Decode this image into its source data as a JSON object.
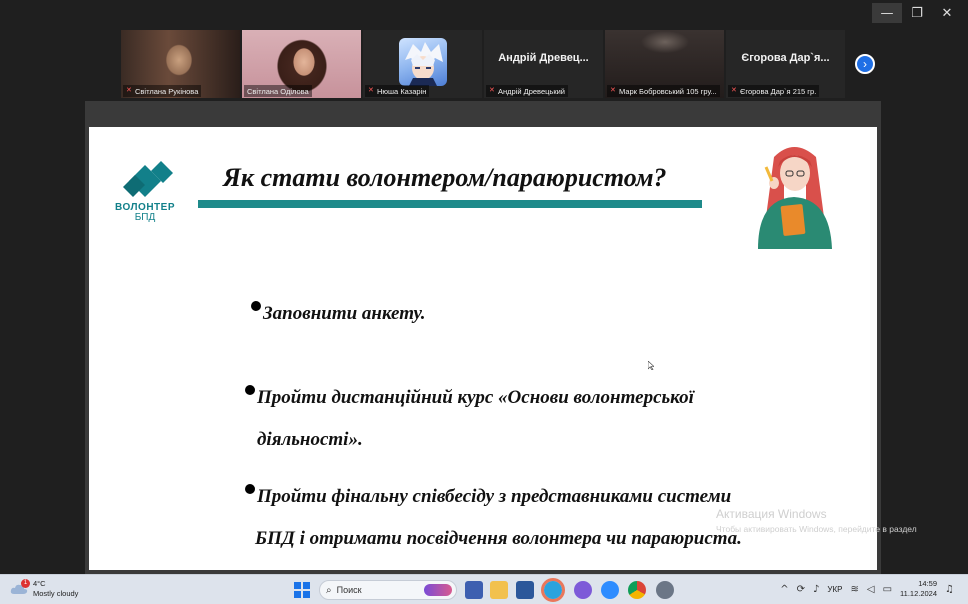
{
  "window": {
    "controls": [
      "—",
      "❐",
      "✕"
    ]
  },
  "participants": [
    {
      "name": "Світлана Рукінова",
      "type": "video",
      "active": false
    },
    {
      "name": "Світлана Оділова",
      "type": "video",
      "active": true
    },
    {
      "name": "Нюша Казарін",
      "type": "avatar",
      "active": false
    },
    {
      "name": "Андрій Древецький",
      "display": "Андрій Древец...",
      "type": "name",
      "active": false
    },
    {
      "name": "Марк Бобровський 105 гру...",
      "type": "video",
      "active": false
    },
    {
      "name": "Єгорова Дар`я 215 гр.",
      "display": "Єгорова Дар`я...",
      "type": "name",
      "active": false
    }
  ],
  "slide": {
    "logo_text": "ВОЛОНТЕР",
    "logo_sub": "БПД",
    "title": "Як стати волонтером/параюристом?",
    "bullets": [
      {
        "lines": [
          "Заповнити анкету."
        ]
      },
      {
        "lines": [
          "Пройти дистанційний курс «Основи волонтерської",
          "діяльності»."
        ]
      },
      {
        "lines": [
          "Пройти фінальну співбесіду з представниками системи",
          "БПД і отримати посвідчення волонтера чи параюриста."
        ]
      }
    ],
    "colors": {
      "accent": "#1e8a8a",
      "logo": "#12808a"
    }
  },
  "activation": {
    "line1": "Активация Windows",
    "line2": "Чтобы активировать Windows, перейдите в раздел"
  },
  "taskbar": {
    "weather_temp": "4°C",
    "weather_desc": "Mostly cloudy",
    "weather_badge": "1",
    "search_placeholder": "Поиск",
    "lang": "УКР",
    "time": "14:59",
    "date": "11.12.2024"
  }
}
